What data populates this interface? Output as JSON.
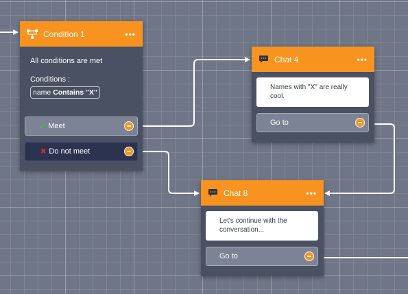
{
  "nodes": {
    "condition1": {
      "title": "Condition 1",
      "menu": "•••",
      "summary": "All conditions are met",
      "conditions_label": "Conditions :",
      "condition_field": "name",
      "condition_rule": "Contains \"X\"",
      "meet": {
        "icon": "checkmark-icon",
        "mark": "✔",
        "label": "Meet"
      },
      "not_meet": {
        "icon": "cross-icon",
        "mark": "✖",
        "label": "Do not meet"
      }
    },
    "chat4": {
      "title": "Chat 4",
      "menu": "•••",
      "message": "Names with \"X\" are really cool.",
      "goto_label": "Go to"
    },
    "chat8": {
      "title": "Chat 8",
      "menu": "•••",
      "message": "Let's continue with the conversation...",
      "goto_label": "Go to"
    }
  },
  "colors": {
    "canvas": "#6f7687",
    "node_body": "#495162",
    "header_orange": "#f7931e",
    "meet_check": "#3ec43e",
    "not_meet_cross": "#e8262a",
    "connector": "#ffffff"
  }
}
